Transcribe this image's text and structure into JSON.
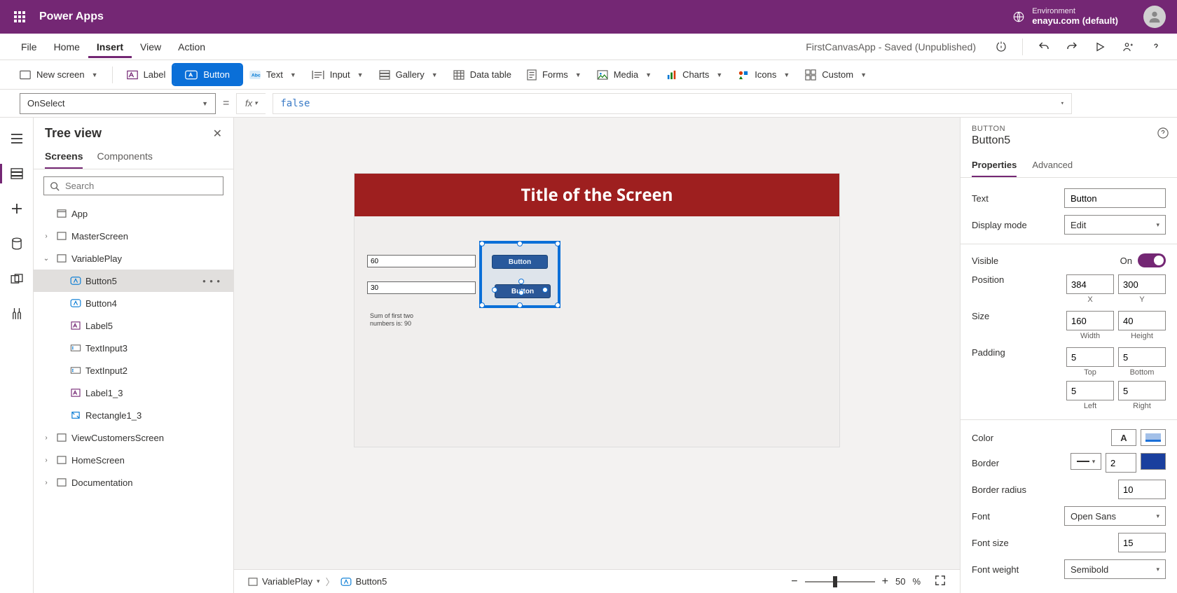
{
  "header": {
    "app_name": "Power Apps",
    "env_label": "Environment",
    "env_name": "enayu.com (default)"
  },
  "menu": {
    "items": [
      "File",
      "Home",
      "Insert",
      "View",
      "Action"
    ],
    "active": "Insert",
    "doc_title": "FirstCanvasApp - Saved (Unpublished)"
  },
  "ribbon": {
    "new_screen": "New screen",
    "label": "Label",
    "button": "Button",
    "text": "Text",
    "input": "Input",
    "gallery": "Gallery",
    "data_table": "Data table",
    "forms": "Forms",
    "media": "Media",
    "charts": "Charts",
    "icons": "Icons",
    "custom": "Custom"
  },
  "formula": {
    "property": "OnSelect",
    "fx": "fx",
    "value": "false"
  },
  "tree": {
    "title": "Tree view",
    "tabs": {
      "screens": "Screens",
      "components": "Components"
    },
    "search_placeholder": "Search",
    "app": "App",
    "items": [
      {
        "name": "MasterScreen",
        "type": "screen",
        "expanded": false
      },
      {
        "name": "VariablePlay",
        "type": "screen",
        "expanded": true,
        "children": [
          {
            "name": "Button5",
            "type": "button",
            "selected": true
          },
          {
            "name": "Button4",
            "type": "button"
          },
          {
            "name": "Label5",
            "type": "label"
          },
          {
            "name": "TextInput3",
            "type": "textinput"
          },
          {
            "name": "TextInput2",
            "type": "textinput"
          },
          {
            "name": "Label1_3",
            "type": "label"
          },
          {
            "name": "Rectangle1_3",
            "type": "rectangle"
          }
        ]
      },
      {
        "name": "ViewCustomersScreen",
        "type": "screen",
        "expanded": false
      },
      {
        "name": "HomeScreen",
        "type": "screen",
        "expanded": false
      },
      {
        "name": "Documentation",
        "type": "screen",
        "expanded": false
      }
    ]
  },
  "canvas": {
    "title": "Title of the Screen",
    "input1": "60",
    "input2": "30",
    "btn1": "Button",
    "btn2": "Button",
    "sum_label_l1": "Sum of first two",
    "sum_label_l2": "numbers is: 90"
  },
  "status": {
    "screen": "VariablePlay",
    "element": "Button5",
    "zoom": "50",
    "zoom_suffix": "%"
  },
  "props": {
    "type": "BUTTON",
    "name": "Button5",
    "tabs": {
      "properties": "Properties",
      "advanced": "Advanced"
    },
    "labels": {
      "text": "Text",
      "display_mode": "Display mode",
      "visible": "Visible",
      "position": "Position",
      "size": "Size",
      "padding": "Padding",
      "color": "Color",
      "border": "Border",
      "border_radius": "Border radius",
      "font": "Font",
      "font_size": "Font size",
      "font_weight": "Font weight"
    },
    "values": {
      "text": "Button",
      "display_mode": "Edit",
      "visible": "On",
      "x": "384",
      "y": "300",
      "width": "160",
      "height": "40",
      "pad_top": "5",
      "pad_bottom": "5",
      "pad_left": "5",
      "pad_right": "5",
      "border_width": "2",
      "border_radius": "10",
      "font": "Open Sans",
      "font_size": "15",
      "font_weight": "Semibold"
    },
    "sublabels": {
      "x": "X",
      "y": "Y",
      "width": "Width",
      "height": "Height",
      "top": "Top",
      "bottom": "Bottom",
      "left": "Left",
      "right": "Right"
    },
    "colors": {
      "font_color": "#000000",
      "fill_color": "#a3c0e8",
      "border_color": "#1a3f9e"
    }
  }
}
